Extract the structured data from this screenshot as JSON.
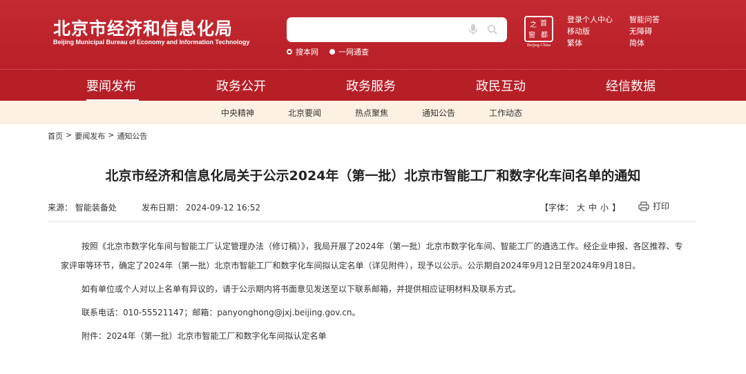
{
  "header": {
    "title": "北京市经济和信息化局",
    "subtitle": "Beijing Municipal Bureau of Economy and Information Technology",
    "search_placeholder": "",
    "search_options": [
      "搜本网",
      "一网通查"
    ],
    "seal_chars": [
      "之",
      "首",
      "都",
      "窗"
    ],
    "seal_caption": "Beijing-China",
    "util_links": [
      "登录个人中心",
      "智能问答",
      "移动版",
      "无障碍",
      "繁体",
      "简体"
    ]
  },
  "nav": {
    "items": [
      "要闻发布",
      "政务公开",
      "政务服务",
      "政民互动",
      "经信数据"
    ]
  },
  "subnav": {
    "items": [
      "中央精神",
      "北京要闻",
      "热点聚焦",
      "通知公告",
      "工作动态"
    ]
  },
  "breadcrumb": {
    "items": [
      "首页",
      "要闻发布",
      "通知公告"
    ],
    "sep": ">"
  },
  "article": {
    "title": "北京市经济和信息化局关于公示2024年（第一批）北京市智能工厂和数字化车间名单的通知",
    "source_label": "来源：",
    "source": "智能装备处",
    "date_label": "发布日期：",
    "date": "2024-09-12 16:52",
    "font_label": "【字体：",
    "font_sizes": [
      "大",
      "中",
      "小"
    ],
    "font_close": "】",
    "print_label": "打印",
    "paragraphs": [
      "按照《北京市数字化车间与智能工厂认定管理办法（修订稿）》，我局开展了2024年（第一批）北京市数字化车间、智能工厂的遴选工作。经企业申报、各区推荐、专家评审等环节，确定了2024年（第一批）北京市智能工厂和数字化车间拟认定名单（详见附件），现予以公示。公示期自2024年9月12日至2024年9月18日。",
      "如有单位或个人对以上名单有异议的，请于公示期内将书面意见发送至以下联系邮箱，并提供相应证明材料及联系方式。",
      "联系电话：010-55521147；邮箱：panyonghong@jxj.beijing.gov.cn。",
      "附件：2024年（第一批）北京市智能工厂和数字化车间拟认定名单"
    ]
  },
  "colors": {
    "brand_red": "#c0252d",
    "subnav_bg": "#fdf1e3"
  }
}
